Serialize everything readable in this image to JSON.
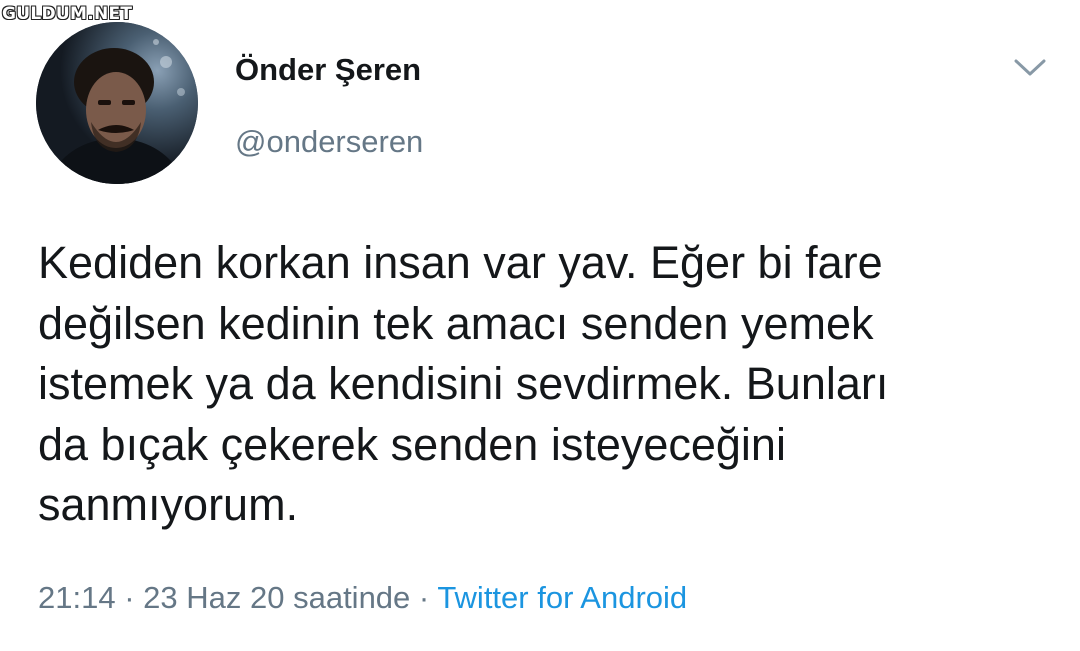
{
  "watermark": "GULDUM.NET",
  "author": {
    "display_name": "Önder Şeren",
    "handle": "@onderseren"
  },
  "tweet": {
    "text": "Kediden korkan insan var yav. Eğer bi fare\ndeğilsen kedinin tek amacı senden yemek\nistemek ya da kendisini sevdirmek. Bunları\nda bıçak çekerek senden isteyeceğini\nsanmıyorum."
  },
  "meta": {
    "time": "21:14",
    "separator": "·",
    "date": "23 Haz 20 saatinde",
    "source": "Twitter for Android"
  },
  "icons": {
    "chevron": "chevron-down-icon"
  },
  "colors": {
    "text_primary": "#14171a",
    "text_secondary": "#657786",
    "link": "#1b95e0",
    "background": "#ffffff"
  }
}
